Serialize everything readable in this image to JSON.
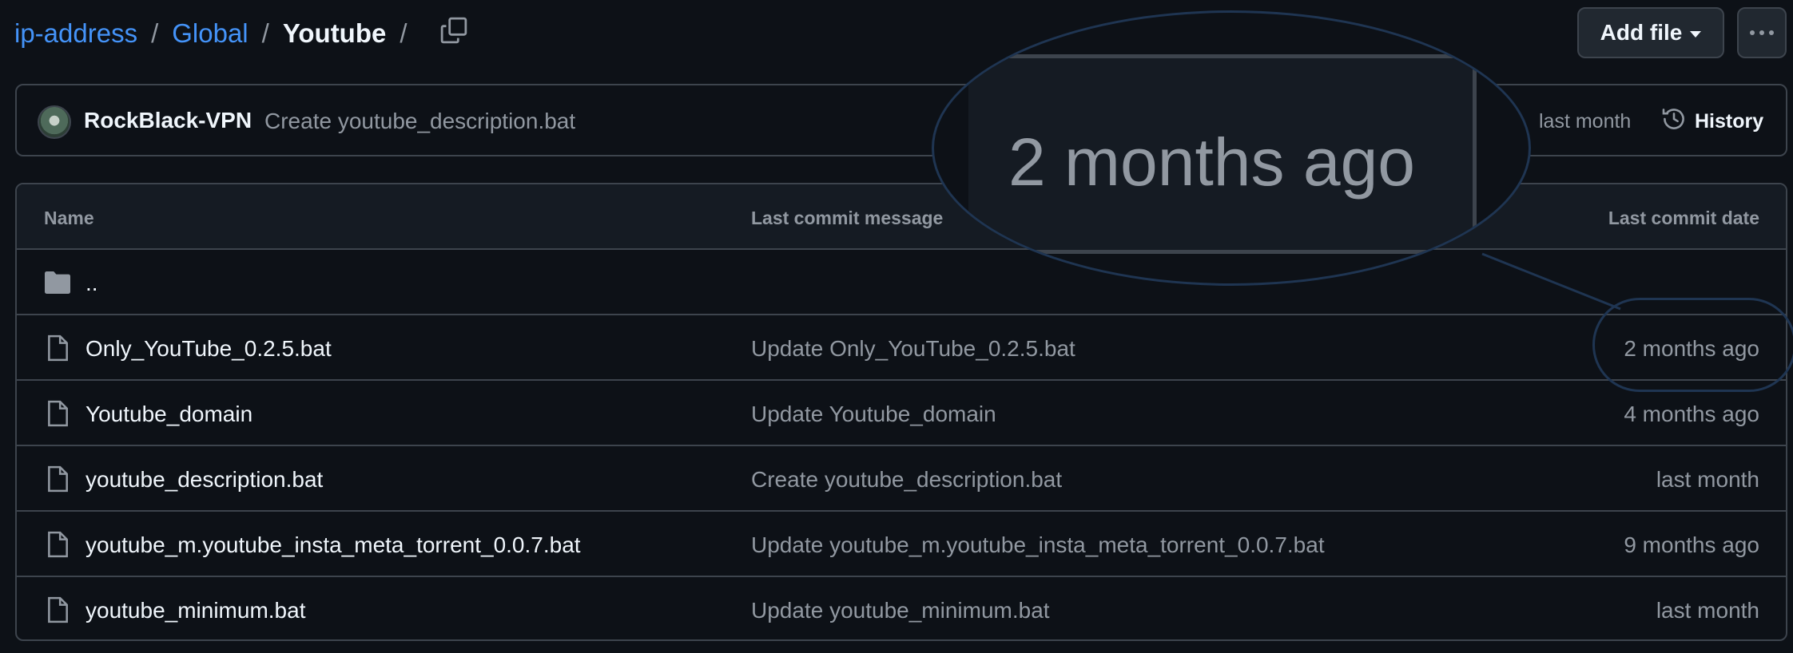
{
  "breadcrumb": {
    "repo": "ip-address",
    "folder": "Global",
    "current": "Youtube",
    "separator": "/"
  },
  "actions": {
    "add_file_label": "Add file"
  },
  "latest_commit": {
    "author": "RockBlack-VPN",
    "message": "Create youtube_description.bat",
    "time": "last month",
    "history_label": "History"
  },
  "table": {
    "headers": {
      "name": "Name",
      "message": "Last commit message",
      "date": "Last commit date"
    },
    "parent_dir": "..",
    "rows": [
      {
        "name": "Only_YouTube_0.2.5.bat",
        "message": "Update Only_YouTube_0.2.5.bat",
        "date": "2 months ago"
      },
      {
        "name": "Youtube_domain",
        "message": "Update Youtube_domain",
        "date": "4 months ago"
      },
      {
        "name": "youtube_description.bat",
        "message": "Create youtube_description.bat",
        "date": "last month"
      },
      {
        "name": "youtube_m.youtube_insta_meta_torrent_0.0.7.bat",
        "message": "Update youtube_m.youtube_insta_meta_torrent_0.0.7.bat",
        "date": "9 months ago"
      },
      {
        "name": "youtube_minimum.bat",
        "message": "Update youtube_minimum.bat",
        "date": "last month"
      }
    ]
  },
  "magnifier": {
    "zoomed_text": "2 months ago"
  },
  "colors": {
    "background": "#0d1117",
    "link": "#4493f8",
    "border": "#3d444d",
    "muted_text": "#9198a1",
    "highlight_ring": "#1f3552"
  },
  "icons": {
    "copy": "copy-icon",
    "history": "history-icon",
    "folder": "folder-icon",
    "file": "file-icon",
    "more": "kebab-horizontal-icon"
  }
}
